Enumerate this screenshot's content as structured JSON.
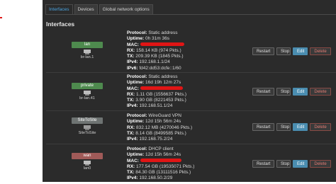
{
  "tabs": [
    "Interfaces",
    "Devices",
    "Global network options"
  ],
  "section_title": "Interfaces",
  "labels": {
    "protocol": "Protocol:",
    "uptime": "Uptime:",
    "mac": "MAC:",
    "rx": "RX:",
    "tx": "TX:",
    "ipv4": "IPv4:",
    "ipv6": "IPv6:"
  },
  "buttons": {
    "restart": "Restart",
    "stop": "Stop",
    "edit": "Edit",
    "delete": "Delete"
  },
  "interfaces": [
    {
      "name": "lan",
      "device": "br-lan.1",
      "color": "#4e8a4e",
      "protocol": "Static address",
      "uptime": "0h 31m 36s",
      "rx": "158.14 KB (974 Pkts.)",
      "tx": "209.39 KB (1845 Pkts.)",
      "ipv4": "192.168.1.1/24",
      "ipv6": "fd42:dd53:dcfe::1/60"
    },
    {
      "name": "private",
      "device": "br-lan.41",
      "color": "#4e8a4e",
      "protocol": "Static address",
      "uptime": "16d 19h 12m 27s",
      "rx": "1.11 GB (1556637 Pkts.)",
      "tx": "3.90 GB (8221453 Pkts.)",
      "ipv4": "192.168.51.1/24"
    },
    {
      "name": "SiteToSite",
      "device": "SiteToSite",
      "color": "#6e7372",
      "protocol": "WireGuard VPN",
      "uptime": "12d 15h 56m 24s",
      "rx": "832.12 MB (4270046 Pkts.)",
      "tx": "8.14 GB (8499585 Pkts.)",
      "ipv4": "192.168.75.2/24"
    },
    {
      "name": "wan",
      "device": "lan0",
      "color": "#a05a58",
      "protocol": "DHCP client",
      "uptime": "12d 15h 56m 24s",
      "rx": "177.54 GB (19535071 Pkts.)",
      "tx": "84.30 GB (13111516 Pkts.)",
      "ipv4": "192.168.50.2/29"
    }
  ]
}
